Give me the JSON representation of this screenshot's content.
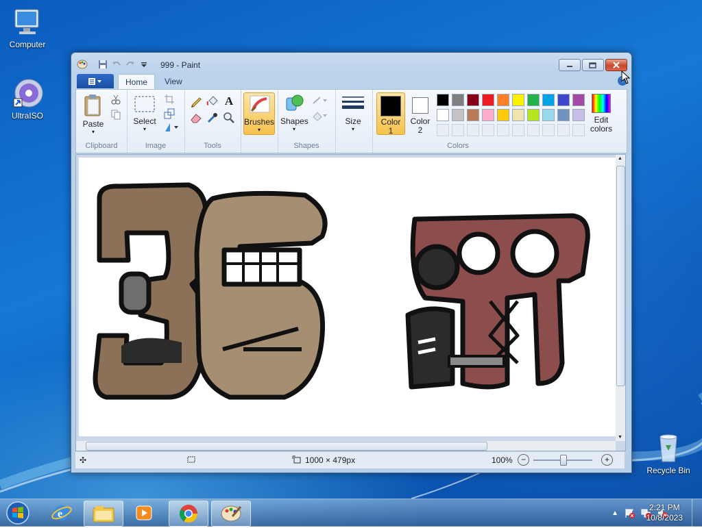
{
  "desktop": {
    "icons": [
      {
        "label": "Computer",
        "icon": "computer-icon"
      },
      {
        "label": "UltraISO",
        "icon": "ultraiso-disc-icon"
      },
      {
        "label": "Recycle Bin",
        "icon": "recycle-bin-icon"
      }
    ]
  },
  "window": {
    "title": "999 - Paint",
    "tabs": [
      "Home",
      "View"
    ],
    "active_tab": "Home"
  },
  "ribbon": {
    "clipboard": {
      "paste": "Paste",
      "label": "Clipboard"
    },
    "image": {
      "select": "Select",
      "label": "Image"
    },
    "tools": {
      "label": "Tools"
    },
    "brushes": {
      "label": "Brushes"
    },
    "shapes": {
      "shapes": "Shapes",
      "label": "Shapes"
    },
    "size": {
      "label": "Size"
    },
    "colors": {
      "color1": "Color\n1",
      "color1_a": "Color",
      "color1_b": "1",
      "color2_a": "Color",
      "color2_b": "2",
      "edit_a": "Edit",
      "edit_b": "colors",
      "label": "Colors",
      "color1_value": "#000000",
      "color2_value": "#ffffff",
      "palette_row1": [
        "#000000",
        "#7f7f7f",
        "#880015",
        "#ed1c24",
        "#ff7f27",
        "#fff200",
        "#22b14c",
        "#00a2e8",
        "#3f48cc",
        "#a349a4"
      ],
      "palette_row2": [
        "#ffffff",
        "#c3c3c3",
        "#b97a57",
        "#ffaec9",
        "#ffc90e",
        "#efe4b0",
        "#b5e61d",
        "#99d9ea",
        "#7092be",
        "#c8bfe7"
      ]
    }
  },
  "status": {
    "dimensions": "1000 × 479px",
    "zoom": "100%"
  },
  "taskbar": {
    "apps": [
      "internet-explorer-icon",
      "file-explorer-icon",
      "media-player-icon",
      "chrome-icon",
      "paint-icon"
    ],
    "time": "2:21 PM",
    "date": "10/8/2023"
  }
}
